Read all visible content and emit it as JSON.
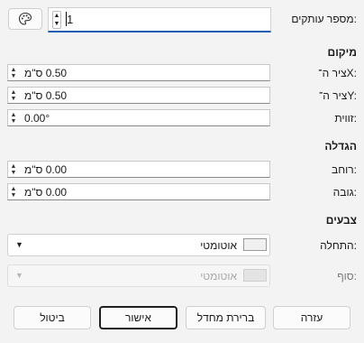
{
  "top": {
    "label": "מספר עותקים:",
    "value": "1"
  },
  "position": {
    "heading": "מיקום",
    "x_label": "ציר ה־X:",
    "x_value": "0.50 ס\"מ",
    "y_label": "ציר ה־Y:",
    "y_value": "0.50 ס\"מ",
    "angle_label": "זווית:",
    "angle_value": "0.00°"
  },
  "enlargement": {
    "heading": "הגדלה",
    "width_label": "רוחב:",
    "width_value": "0.00 ס\"מ",
    "height_label": "גובה:",
    "height_value": "0.00 ס\"מ"
  },
  "colors": {
    "heading": "צבעים",
    "start_label": "התחלה:",
    "start_value": "אוטומטי",
    "end_label": "סוף:",
    "end_value": "אוטומטי"
  },
  "buttons": {
    "help": "עזרה",
    "reset": "ברירת מחדל",
    "ok": "אישור",
    "cancel": "ביטול"
  },
  "icons": {
    "palette": "palette-icon",
    "spin_up": "chevron-up-icon",
    "spin_down": "chevron-down-icon",
    "dropdown": "dropdown-arrow-icon"
  }
}
